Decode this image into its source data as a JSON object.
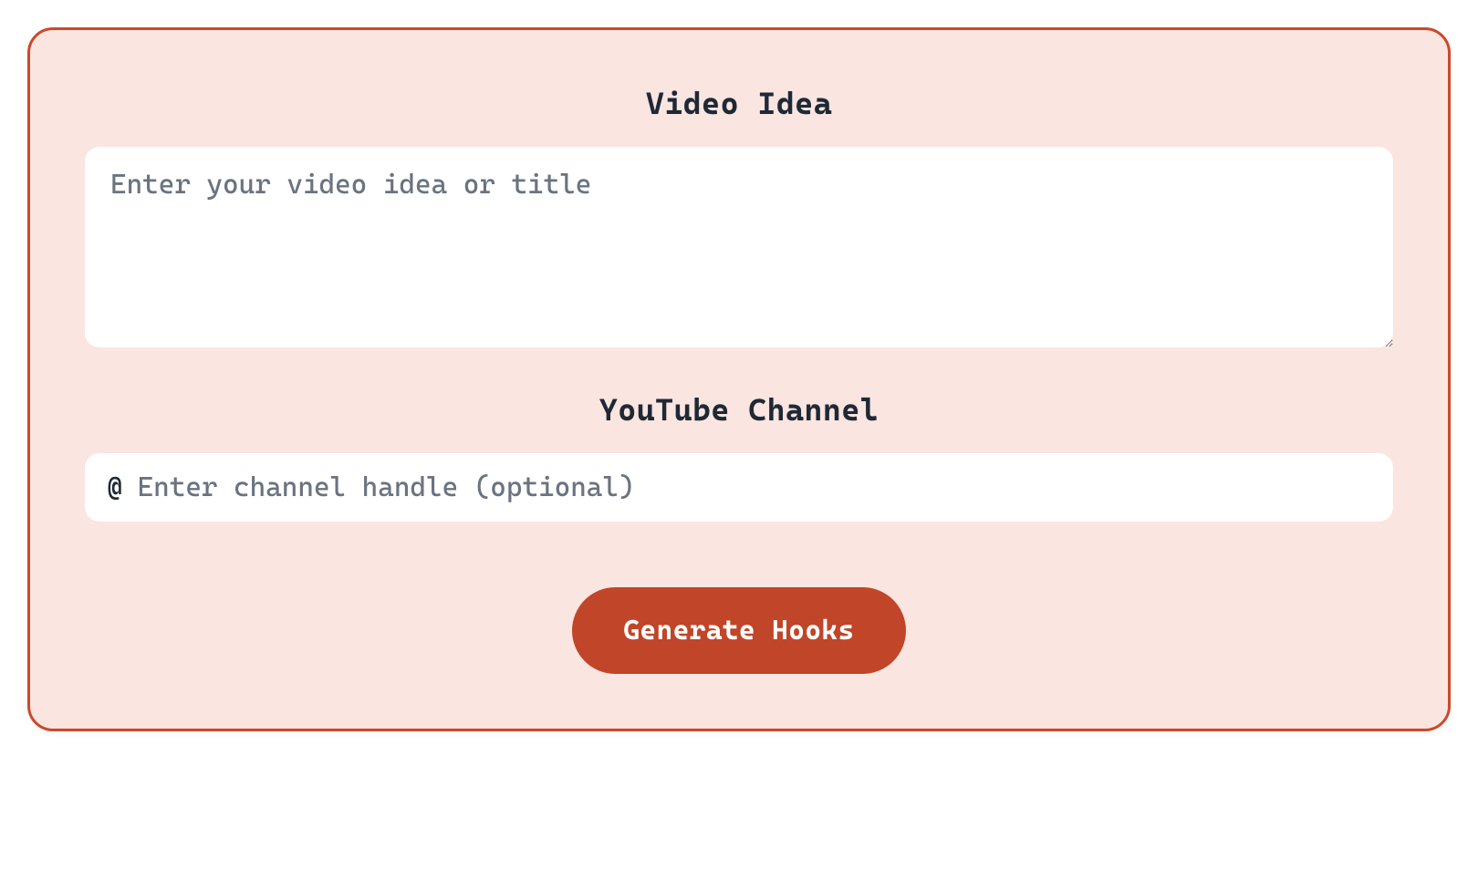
{
  "form": {
    "videoIdea": {
      "label": "Video Idea",
      "placeholder": "Enter your video idea or title",
      "value": ""
    },
    "youtubeChannel": {
      "label": "YouTube Channel",
      "prefix": "@",
      "placeholder": "Enter channel handle (optional)",
      "value": ""
    },
    "generateButton": {
      "label": "Generate Hooks"
    }
  }
}
